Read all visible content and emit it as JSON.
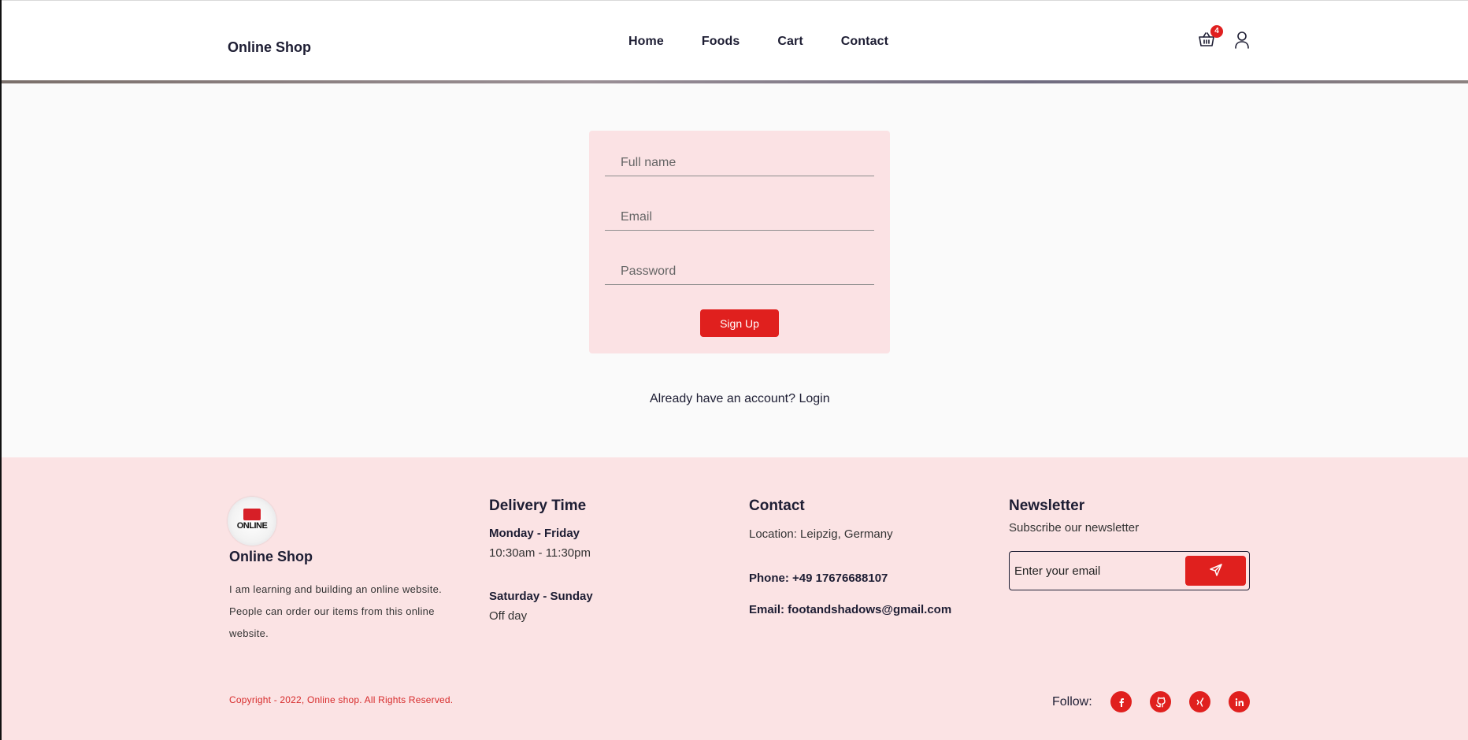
{
  "header": {
    "logo": "Online Shop",
    "nav": [
      "Home",
      "Foods",
      "Cart",
      "Contact"
    ],
    "cart_count": "4",
    "cart_icon": "basket-icon",
    "user_icon": "user-icon"
  },
  "signup": {
    "full_name_placeholder": "Full name",
    "email_placeholder": "Email",
    "password_placeholder": "Password",
    "submit_label": "Sign Up",
    "login_prompt": "Already have an account?",
    "login_link": "Login"
  },
  "footer": {
    "logo_word": "ONLINE",
    "brand": "Online Shop",
    "about": "I am learning and building an online website. People can order our items from this online website.",
    "delivery": {
      "title": "Delivery Time",
      "weekday_label": "Monday - Friday",
      "weekday_hours": "10:30am - 11:30pm",
      "weekend_label": "Saturday - Sunday",
      "weekend_hours": "Off day"
    },
    "contact": {
      "title": "Contact",
      "location": "Location: Leipzig, Germany",
      "phone": "Phone: +49 17676688107",
      "email": "Email: footandshadows@gmail.com"
    },
    "newsletter": {
      "title": "Newsletter",
      "subtitle": "Subscribe our newsletter",
      "placeholder": "Enter your email",
      "send_icon": "send-icon"
    },
    "copyright": "Copyright - 2022, Online shop. All Rights Reserved.",
    "follow_label": "Follow:",
    "social_icons": [
      "facebook-icon",
      "github-icon",
      "xing-icon",
      "linkedin-icon"
    ]
  },
  "colors": {
    "accent": "#e0201e",
    "form_bg": "#fbe2e4",
    "footer_bg": "#fbe3e4",
    "text_dark": "#1d1d33"
  }
}
